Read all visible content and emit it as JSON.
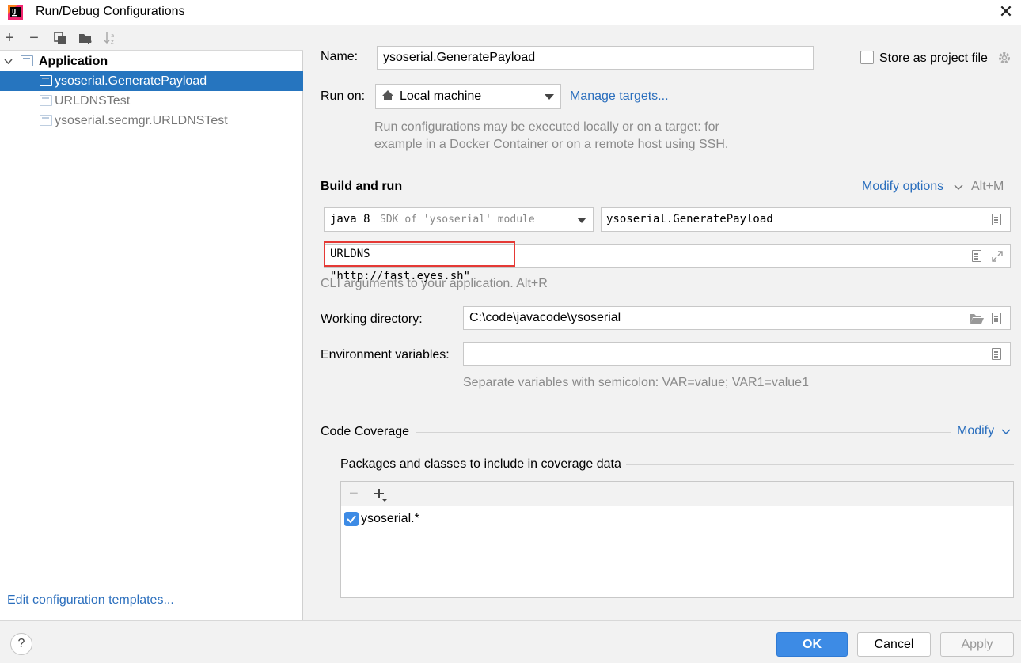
{
  "window": {
    "title": "Run/Debug Configurations",
    "close_label": "✕"
  },
  "toolbar": {
    "add": "+",
    "remove": "−"
  },
  "tree": {
    "group": "Application",
    "items": [
      {
        "label": "ysoserial.GeneratePayload",
        "selected": true
      },
      {
        "label": "URLDNSTest",
        "selected": false
      },
      {
        "label": "ysoserial.secmgr.URLDNSTest",
        "selected": false
      }
    ]
  },
  "edit_templates_link": "Edit configuration templates...",
  "form": {
    "name_label": "Name:",
    "name_value": "ysoserial.GeneratePayload",
    "store_label": "Store as project file",
    "store_checked": false,
    "run_on_label": "Run on:",
    "run_on_value": "Local machine",
    "manage_targets": "Manage targets...",
    "run_on_hint_1": "Run configurations may be executed locally or on a target: for",
    "run_on_hint_2": "example in a Docker Container or on a remote host using SSH.",
    "build_run_title": "Build and run",
    "modify_options": "Modify options",
    "modify_shortcut": "Alt+M",
    "jdk_main": "java 8",
    "jdk_sub": "SDK of 'ysoserial' module",
    "main_class": "ysoserial.GeneratePayload",
    "program_args": "URLDNS \"http://fast.eyes.sh\"",
    "cli_hint": "CLI arguments to your application. Alt+R",
    "workdir_label": "Working directory:",
    "workdir_value": "C:\\code\\javacode\\ysoserial",
    "env_label": "Environment variables:",
    "env_value": "",
    "env_hint": "Separate variables with semicolon: VAR=value; VAR1=value1",
    "coverage_title": "Code Coverage",
    "coverage_modify": "Modify",
    "packages_title": "Packages and classes to include in coverage data",
    "packages": [
      {
        "label": "ysoserial.*",
        "checked": true
      }
    ]
  },
  "buttons": {
    "ok": "OK",
    "cancel": "Cancel",
    "apply": "Apply"
  },
  "colors": {
    "accent": "#2675bf",
    "link": "#2a6ebd",
    "highlight_box": "#e53935"
  }
}
